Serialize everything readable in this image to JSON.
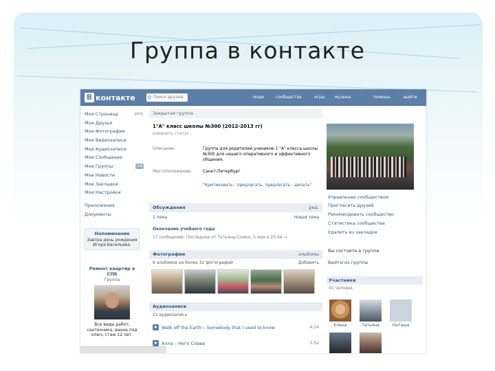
{
  "slide": {
    "title": "Группа в контакте"
  },
  "topbar": {
    "logo_letter": "В",
    "logo_text": "контакте",
    "search_placeholder": "Поиск друзей",
    "nav": [
      "люди",
      "сообщества",
      "игры",
      "музыка",
      "помощь",
      "выйти"
    ]
  },
  "sidebar": {
    "items": [
      {
        "label": "Моя Страница",
        "extra": "ред."
      },
      {
        "label": "Мои Друзья"
      },
      {
        "label": "Мои Фотографии"
      },
      {
        "label": "Мои Видеозаписи"
      },
      {
        "label": "Мои Аудиозаписи"
      },
      {
        "label": "Мои Сообщения"
      },
      {
        "label": "Мои Группы",
        "badge": "+4"
      },
      {
        "label": "Мои Новости"
      },
      {
        "label": "Мои Закладки"
      },
      {
        "label": "Мои Настройки"
      }
    ],
    "items2": [
      "Приложения",
      "Документы"
    ],
    "notice": {
      "title": "Напоминание",
      "body": "Завтра день рождения Игоря Васильева."
    },
    "ad": {
      "title": "Ремонт квартир в СПб",
      "subtitle": "Группа",
      "text": "Все виды работ, сантехника, ванна под ключ, стаж 12 лет."
    }
  },
  "group": {
    "type": "Закрытая группа",
    "name": "1\"А\" класс школы №300 (2012-2013 гг)",
    "status": "изменить статус",
    "info": [
      {
        "key": "Описание:",
        "value": "Группа для родителей учеников 1 \"А\" класса школы №300 для нашего оперативного и эффективного общения."
      },
      {
        "key": "Местоположение:",
        "value": "Санкт-Петербург"
      }
    ],
    "quote": "\"Критиковать - предлагать, предлагать - делать\"",
    "board": {
      "title": "Обсуждения",
      "action": "ред.",
      "count": "1 тема",
      "action2": "Новая тема"
    },
    "topic": {
      "title": "Окончание учебного года",
      "meta": "17 сообщений. Последнее от Татьяны Сомко, 5 мая в 20:44 →"
    },
    "photos": {
      "title": "Фотографии",
      "action": "альбомы",
      "meta": "6 альбомов не более 32 фотографий",
      "action2": "Добавить"
    },
    "audio": {
      "title": "Аудиозаписи",
      "count": "21 аудиозапись"
    },
    "tracks": [
      {
        "title": "Walk off the Earth – Somebody that I used to know",
        "duration": "4:24"
      },
      {
        "title": "Алла – Него Слава",
        "duration": "3:52"
      }
    ]
  },
  "right": {
    "links": [
      "Управление сообществом",
      "Пригласить друзей",
      "Рекомендовать сообщество",
      "Статистика сообщества",
      "Удалить из закладок"
    ],
    "status_line": "Вы состоите в группе.",
    "leave": "Выйти из группы",
    "members": {
      "title": "Участники",
      "count": "45 человек",
      "people": [
        "Елена",
        "Татьяна",
        "Наташа"
      ]
    }
  },
  "colors": {
    "accent": "#5b7fa6",
    "link": "#2b587a"
  }
}
